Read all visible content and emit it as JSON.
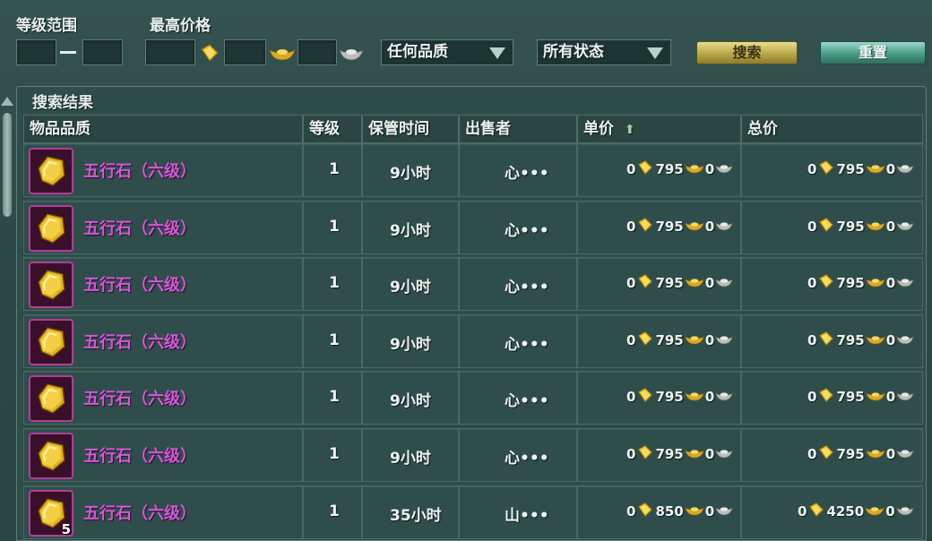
{
  "filters": {
    "level_label": "等级范围",
    "price_label": "最高价格",
    "level_dash": "—",
    "quality_select": "任何品质",
    "status_select": "所有状态",
    "search_button": "搜索",
    "reset_button": "重置"
  },
  "results": {
    "title": "搜索结果",
    "columns": [
      "物品品质",
      "等级",
      "保管时间",
      "出售者",
      "单价",
      "总价"
    ],
    "sort_icon": "sort-ascending-icon",
    "rows": [
      {
        "name": "五行石（六级）",
        "level": "1",
        "time": "9小时",
        "seller": "心•••",
        "unit": [
          "0",
          "795",
          "0"
        ],
        "total": [
          "0",
          "795",
          "0"
        ],
        "stack": ""
      },
      {
        "name": "五行石（六级）",
        "level": "1",
        "time": "9小时",
        "seller": "心•••",
        "unit": [
          "0",
          "795",
          "0"
        ],
        "total": [
          "0",
          "795",
          "0"
        ],
        "stack": ""
      },
      {
        "name": "五行石（六级）",
        "level": "1",
        "time": "9小时",
        "seller": "心•••",
        "unit": [
          "0",
          "795",
          "0"
        ],
        "total": [
          "0",
          "795",
          "0"
        ],
        "stack": ""
      },
      {
        "name": "五行石（六级）",
        "level": "1",
        "time": "9小时",
        "seller": "心•••",
        "unit": [
          "0",
          "795",
          "0"
        ],
        "total": [
          "0",
          "795",
          "0"
        ],
        "stack": ""
      },
      {
        "name": "五行石（六级）",
        "level": "1",
        "time": "9小时",
        "seller": "心•••",
        "unit": [
          "0",
          "795",
          "0"
        ],
        "total": [
          "0",
          "795",
          "0"
        ],
        "stack": ""
      },
      {
        "name": "五行石（六级）",
        "level": "1",
        "time": "9小时",
        "seller": "心•••",
        "unit": [
          "0",
          "795",
          "0"
        ],
        "total": [
          "0",
          "795",
          "0"
        ],
        "stack": ""
      },
      {
        "name": "五行石（六级）",
        "level": "1",
        "time": "35小时",
        "seller": "山•••",
        "unit": [
          "0",
          "850",
          "0"
        ],
        "total": [
          "0",
          "4250",
          "0"
        ],
        "stack": "5"
      }
    ]
  },
  "colors": {
    "item_name": "#d25ad6",
    "gold": "#e8c23a",
    "silver": "#c8ccc8"
  },
  "icons": [
    "gold-ingot-icon",
    "gold-tael-icon",
    "silver-tael-icon",
    "dropdown-arrow-icon",
    "five-element-stone-icon"
  ]
}
